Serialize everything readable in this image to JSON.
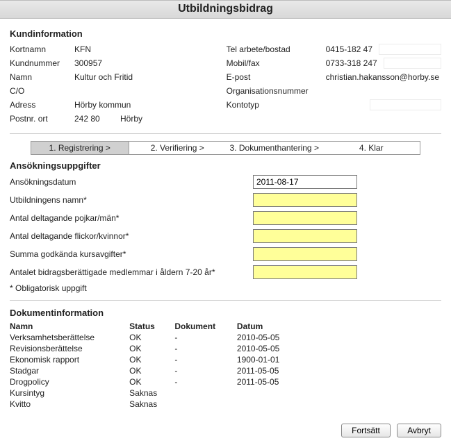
{
  "title": "Utbildningsbidrag",
  "sections": {
    "customer": "Kundinformation",
    "application": "Ansökningsuppgifter",
    "documents": "Dokumentinformation"
  },
  "customer": {
    "left": {
      "kortnamn_lbl": "Kortnamn",
      "kortnamn": "KFN",
      "kundnummer_lbl": "Kundnummer",
      "kundnummer": "300957",
      "namn_lbl": "Namn",
      "namn": "Kultur och Fritid",
      "co_lbl": "C/O",
      "co": "",
      "adress_lbl": "Adress",
      "adress": "Hörby kommun",
      "postnr_lbl": "Postnr. ort",
      "postnr": "242 80",
      "ort": "Hörby"
    },
    "right": {
      "tel_lbl": "Tel arbete/bostad",
      "tel": "0415-182 47",
      "mobil_lbl": "Mobil/fax",
      "mobil": "0733-318 247",
      "epost_lbl": "E-post",
      "epost": "christian.hakansson@horby.se",
      "orgnr_lbl": "Organisationsnummer",
      "orgnr": "",
      "kontotyp_lbl": "Kontotyp",
      "kontotyp": ""
    }
  },
  "steps": {
    "s1": "1. Registrering    >",
    "s2": "2. Verifiering    >",
    "s3": "3. Dokumenthantering >",
    "s4": "4. Klar"
  },
  "form": {
    "datum_lbl": "Ansökningsdatum",
    "datum": "2011-08-17",
    "utb_lbl": "Utbildningens namn*",
    "utb": "",
    "pojkar_lbl": "Antal deltagande pojkar/män*",
    "pojkar": "",
    "flickor_lbl": "Antal deltagande flickor/kvinnor*",
    "flickor": "",
    "summa_lbl": "Summa godkända kursavgifter*",
    "summa": "",
    "medlem_lbl": "Antalet bidragsberättigade medlemmar i åldern 7-20 år*",
    "medlem": "",
    "required_note": "* Obligatorisk uppgift"
  },
  "docs": {
    "headers": {
      "namn": "Namn",
      "status": "Status",
      "dokument": "Dokument",
      "datum": "Datum"
    },
    "rows": [
      {
        "namn": "Verksamhetsberättelse",
        "status": "OK",
        "dokument": "-",
        "datum": "2010-05-05"
      },
      {
        "namn": "Revisionsberättelse",
        "status": "OK",
        "dokument": "-",
        "datum": "2010-05-05"
      },
      {
        "namn": "Ekonomisk rapport",
        "status": "OK",
        "dokument": "-",
        "datum": "1900-01-01"
      },
      {
        "namn": "Stadgar",
        "status": "OK",
        "dokument": "-",
        "datum": "2011-05-05"
      },
      {
        "namn": "Drogpolicy",
        "status": "OK",
        "dokument": "-",
        "datum": "2011-05-05"
      },
      {
        "namn": "Kursintyg",
        "status": "Saknas",
        "dokument": "",
        "datum": ""
      },
      {
        "namn": "Kvitto",
        "status": "Saknas",
        "dokument": "",
        "datum": ""
      }
    ]
  },
  "buttons": {
    "fortsatt": "Fortsätt",
    "avbryt": "Avbryt"
  }
}
